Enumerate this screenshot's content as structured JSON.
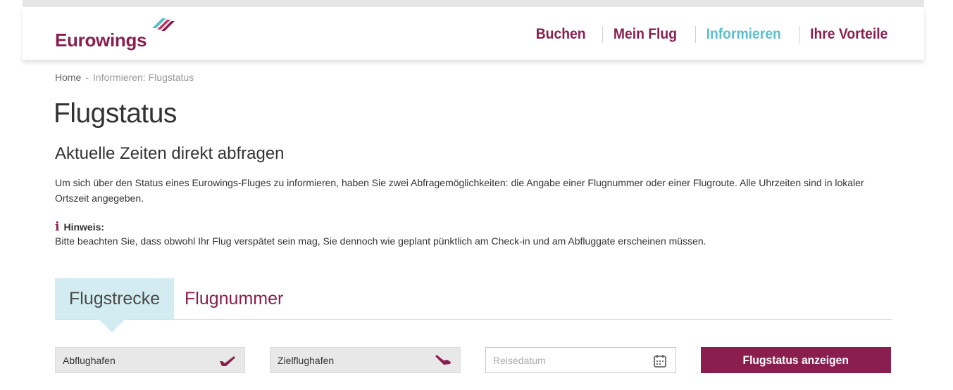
{
  "header": {
    "logo": "Eurowings",
    "nav": [
      "Buchen",
      "Mein Flug",
      "Informieren",
      "Ihre Vorteile"
    ],
    "active_nav": "Informieren"
  },
  "breadcrumb": {
    "home": "Home",
    "separator": "-",
    "current": "Informieren: Flugstatus"
  },
  "page": {
    "title": "Flugstatus",
    "subtitle": "Aktuelle Zeiten direkt abfragen",
    "intro": "Um sich über den Status eines Eurowings-Fluges zu informieren, haben Sie zwei Abfragemöglichkeiten: die Angabe einer Flugnummer oder einer Flugroute. Alle Uhrzeiten sind in lokaler Ortszeit angegeben.",
    "notice_icon": "info-icon",
    "notice_title": "Hinweis:",
    "notice_text": "Bitte beachten Sie, dass obwohl Ihr Flug verspätet sein mag, Sie dennoch wie geplant pünktlich am Check-in und am Abfluggate erscheinen müssen."
  },
  "tabs": {
    "active": "Flugstrecke",
    "inactive": "Flugnummer"
  },
  "form": {
    "departure": "Abflughafen",
    "arrival": "Zielflughafen",
    "date_placeholder": "Reisedatum",
    "submit": "Flugstatus anzeigen"
  },
  "colors": {
    "brand": "#8a1f4f",
    "active_nav": "#5bc0cc",
    "tab_active_bg": "#d2ecf1"
  }
}
